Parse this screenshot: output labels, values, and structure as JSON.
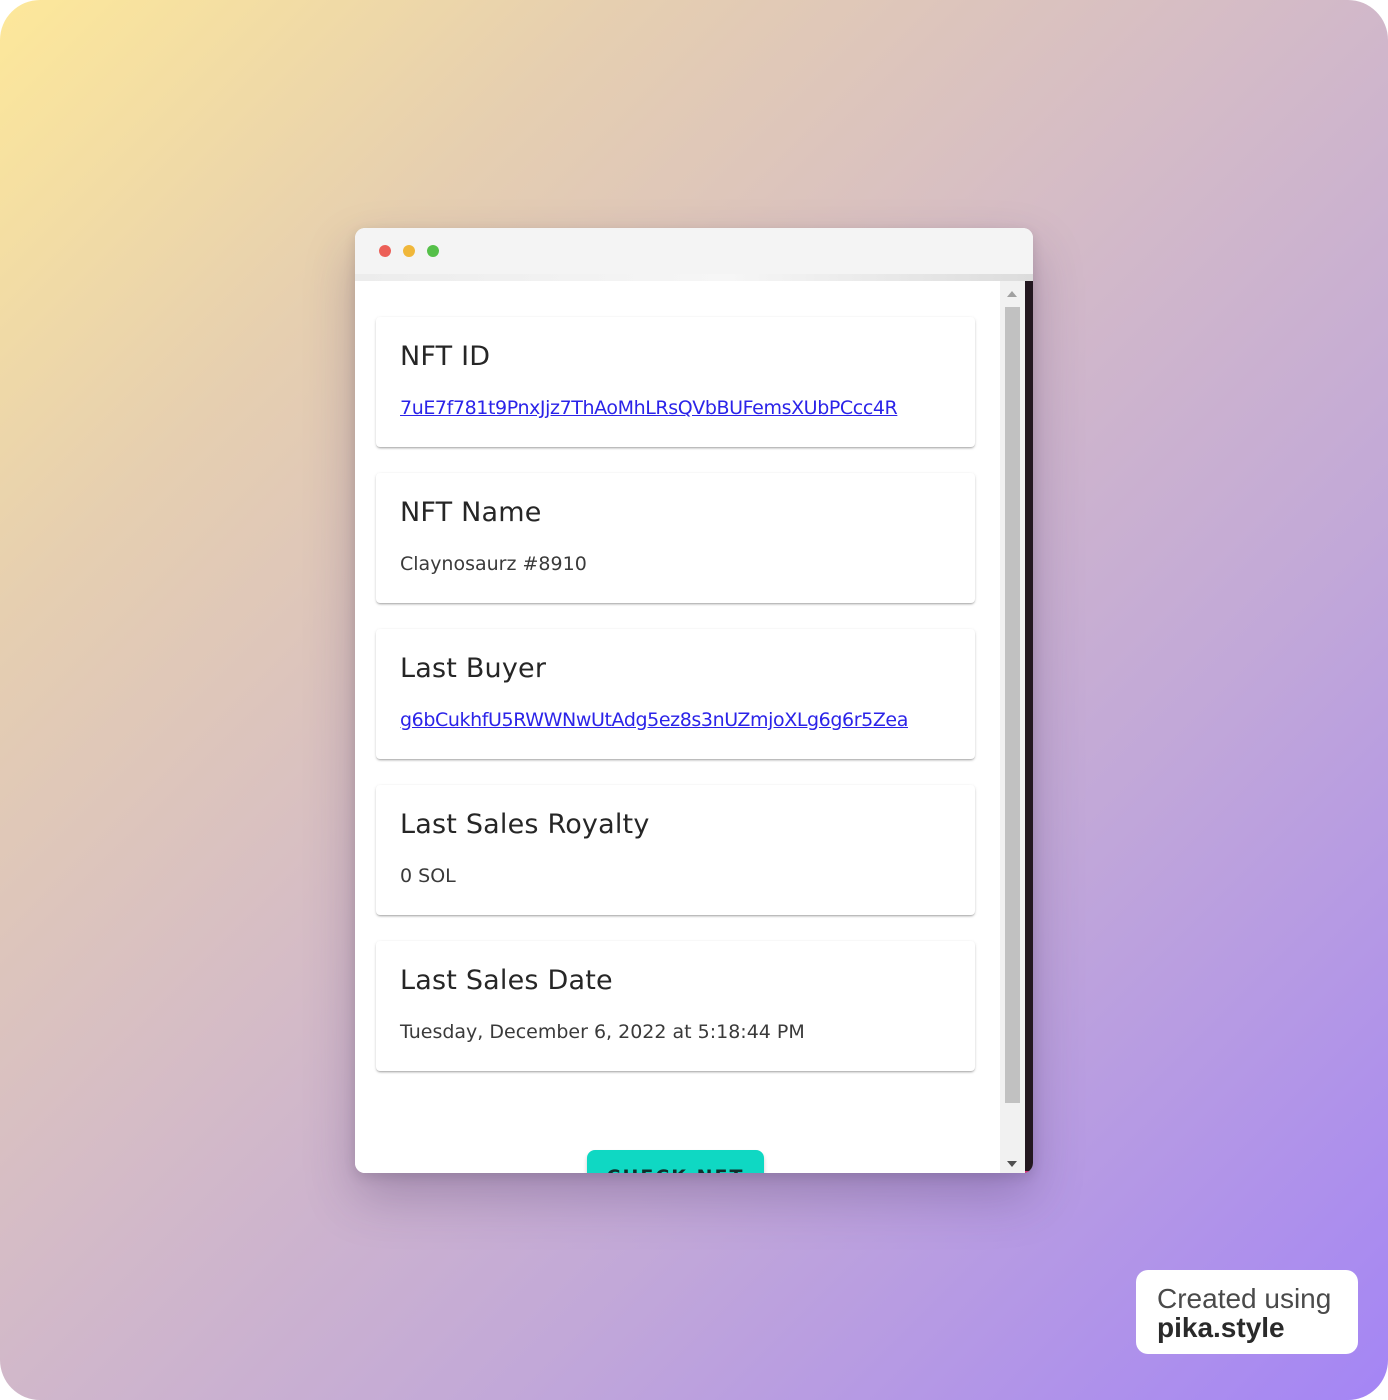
{
  "cards": [
    {
      "title": "NFT ID",
      "value": "7uE7f781t9PnxJjz7ThAoMhLRsQVbBUFemsXUbPCcc4R",
      "is_link": true
    },
    {
      "title": "NFT Name",
      "value": "Claynosaurz #8910",
      "is_link": false
    },
    {
      "title": "Last Buyer",
      "value": "g6bCukhfU5RWWNwUtAdg5ez8s3nUZmjoXLg6g6r5Zea",
      "is_link": true
    },
    {
      "title": "Last Sales Royalty",
      "value": "0 SOL",
      "is_link": false
    },
    {
      "title": "Last Sales Date",
      "value": "Tuesday, December 6, 2022 at 5:18:44 PM",
      "is_link": false
    }
  ],
  "actions": {
    "check_nft_label": "CHECK NFT"
  },
  "watermark": {
    "line1": "Created using",
    "line2": "pika.style"
  },
  "colors": {
    "accent": "#0fd8c3",
    "link": "#2b23e8",
    "window_dot_close": "#ec5f57",
    "window_dot_minimize": "#f0b73a",
    "window_dot_zoom": "#55c049"
  }
}
